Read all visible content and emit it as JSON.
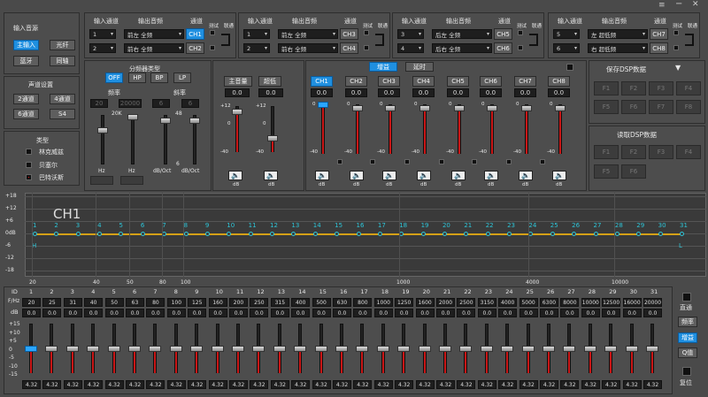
{
  "window": {
    "icons": [
      "menu-icon",
      "minimize-icon",
      "close-icon"
    ]
  },
  "input_source": {
    "title": "输入音源",
    "buttons": [
      "主输入",
      "光纤",
      "蓝牙",
      "同轴"
    ],
    "active": 0
  },
  "channel_settings": {
    "title": "声道设置",
    "buttons": [
      "2通道",
      "4通道",
      "6通道",
      "S4"
    ]
  },
  "type_panel": {
    "title": "类型",
    "options": [
      "林克威兹",
      "贝塞尔",
      "巴特沃斯"
    ],
    "checked": 2
  },
  "routing": {
    "h_input": "输入通道",
    "h_output": "输出音频",
    "h_channel": "通道",
    "h_test": "测试",
    "h_link": "联通",
    "groups": [
      {
        "rows": [
          {
            "in": "1",
            "out": "前左 全频",
            "ch": "CH1"
          },
          {
            "in": "2",
            "out": "前右 全频",
            "ch": "CH2"
          }
        ],
        "active": 0
      },
      {
        "rows": [
          {
            "in": "1",
            "out": "前左 全频",
            "ch": "CH3"
          },
          {
            "in": "2",
            "out": "前右 全频",
            "ch": "CH4"
          }
        ],
        "active": -1
      },
      {
        "rows": [
          {
            "in": "3",
            "out": "后左 全频",
            "ch": "CH5"
          },
          {
            "in": "4",
            "out": "后右 全频",
            "ch": "CH6"
          }
        ],
        "active": -1
      },
      {
        "rows": [
          {
            "in": "5",
            "out": "左 超低频",
            "ch": "CH7"
          },
          {
            "in": "6",
            "out": "右 超低频",
            "ch": "CH8"
          }
        ],
        "active": -1
      }
    ]
  },
  "crossover": {
    "title": "分频器类型",
    "types": [
      "OFF",
      "HP",
      "BP",
      "LP"
    ],
    "active": 0,
    "freq_label": "频率",
    "slope_label": "斜率",
    "freq_values": [
      "20",
      "20000"
    ],
    "slope_values": [
      "6",
      "6"
    ],
    "freq_unit": "Hz",
    "slope_unit": "dB/Oct",
    "freq_top": "20K",
    "slope_top": "48",
    "bottom": "6",
    "pos_hp": 0.7,
    "pos_lp": 0.96,
    "pos_s1": 0.9,
    "pos_s2": 0.9
  },
  "mix": {
    "buttons": [
      "主音量",
      "超低"
    ],
    "values": [
      "0.0",
      "0.0"
    ],
    "scale": [
      "+12",
      "0",
      "-40"
    ],
    "levels": [
      0.88,
      0.3
    ]
  },
  "ch_strip": {
    "mode": [
      "增益",
      "延时"
    ],
    "mode_active": 0,
    "channels": [
      "CH1",
      "CH2",
      "CH3",
      "CH4",
      "CH5",
      "CH6",
      "CH7",
      "CH8"
    ],
    "active": 0,
    "values": [
      "0.0",
      "0.0",
      "0.0",
      "0.0",
      "0.0",
      "0.0",
      "0.0",
      "0.0"
    ],
    "scale": [
      "0",
      "-40"
    ],
    "unit": "dB",
    "levels": [
      1,
      0.92,
      0.92,
      0.92,
      0.92,
      0.92,
      0.92,
      0.92
    ]
  },
  "presets": {
    "save_title": "保存DSP数据",
    "load_title": "读取DSP数据",
    "save_slots": [
      "F1",
      "F2",
      "F3",
      "F4",
      "F5",
      "F6",
      "F7",
      "F8"
    ],
    "load_slots": [
      "F1",
      "F2",
      "F3",
      "F4",
      "F5",
      "F6"
    ]
  },
  "eq_graph": {
    "label": "CH1",
    "db_labels": [
      "+18",
      "+12",
      "+6",
      "0dB",
      "-6",
      "-12",
      "-18"
    ],
    "freq_labels": [
      "20",
      "40",
      "50",
      "80",
      "100",
      "1000",
      "4000",
      "10000"
    ],
    "point_labels": [
      "1",
      "2",
      "3",
      "4",
      "5",
      "6",
      "7",
      "8",
      "9",
      "10",
      "11",
      "12",
      "13",
      "14",
      "15",
      "16",
      "17",
      "18",
      "19",
      "20",
      "21",
      "22",
      "23",
      "24",
      "25",
      "26",
      "27",
      "28",
      "29",
      "30",
      "31"
    ],
    "hp_mark": "H",
    "lp_mark": "L"
  },
  "eq_table": {
    "row_labels": [
      "ID",
      "F/Hz",
      "dB"
    ],
    "ids": [
      "1",
      "2",
      "3",
      "4",
      "5",
      "6",
      "7",
      "8",
      "9",
      "10",
      "11",
      "12",
      "13",
      "14",
      "15",
      "16",
      "17",
      "18",
      "19",
      "20",
      "21",
      "22",
      "23",
      "24",
      "25",
      "26",
      "27",
      "28",
      "29",
      "30",
      "31"
    ],
    "freqs": [
      "20",
      "25",
      "31",
      "40",
      "50",
      "63",
      "80",
      "100",
      "125",
      "160",
      "200",
      "250",
      "315",
      "400",
      "500",
      "630",
      "800",
      "1000",
      "1250",
      "1600",
      "2000",
      "2500",
      "3150",
      "4000",
      "5000",
      "6300",
      "8000",
      "10000",
      "12500",
      "16000",
      "20000"
    ],
    "dbs": [
      "0.0",
      "0.0",
      "0.0",
      "0.0",
      "0.0",
      "0.0",
      "0.0",
      "0.0",
      "0.0",
      "0.0",
      "0.0",
      "0.0",
      "0.0",
      "0.0",
      "0.0",
      "0.0",
      "0.0",
      "0.0",
      "0.0",
      "0.0",
      "0.0",
      "0.0",
      "0.0",
      "0.0",
      "0.0",
      "0.0",
      "0.0",
      "0.0",
      "0.0",
      "0.0",
      "0.0"
    ],
    "scale": [
      "+15",
      "+10",
      "+5",
      "0",
      "-5",
      "-10",
      "-15"
    ],
    "q_values": [
      "4.32",
      "4.32",
      "4.32",
      "4.32",
      "4.32",
      "4.32",
      "4.32",
      "4.32",
      "4.32",
      "4.32",
      "4.32",
      "4.32",
      "4.32",
      "4.32",
      "4.32",
      "4.32",
      "4.32",
      "4.32",
      "4.32",
      "4.32",
      "4.32",
      "4.32",
      "4.32",
      "4.32",
      "4.32",
      "4.32",
      "4.32",
      "4.32",
      "4.32",
      "4.32",
      "4.32"
    ]
  },
  "side": {
    "bypass": "直通",
    "buttons": [
      "频率",
      "增益",
      "Q值",
      "复位"
    ],
    "active": 1
  },
  "colors": {
    "accent": "#1f8fe0",
    "meter": "#c81616",
    "eq_line": "#d4a017",
    "eq_points": "#2ec5d8"
  }
}
